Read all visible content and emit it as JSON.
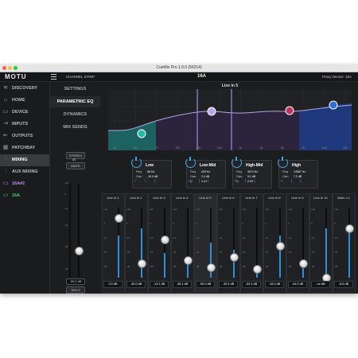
{
  "window": {
    "title": "CueMix Pro 1.0.0 (56214)"
  },
  "topbar": {
    "logo": "MOTU",
    "section": "CHANNEL STRIP",
    "channel": "16A",
    "proxy": "Proxy Device: 16A"
  },
  "sidebar": {
    "items": [
      {
        "label": "DISCOVERY",
        "icon": "wifi-icon"
      },
      {
        "label": "HOME",
        "icon": "home-icon"
      },
      {
        "label": "DEVICE",
        "icon": "device-icon"
      },
      {
        "label": "INPUTS",
        "icon": "input-icon"
      },
      {
        "label": "OUTPUTS",
        "icon": "output-icon"
      },
      {
        "label": "PATCHBAY",
        "icon": "grid-icon"
      },
      {
        "label": "MIXING",
        "icon": "mixer-icon"
      },
      {
        "label": "AUX MIXING",
        "icon": "aux-icon"
      },
      {
        "label": "16A#2",
        "icon": "device-icon"
      },
      {
        "label": "16A",
        "icon": "device-icon"
      }
    ]
  },
  "submenu": {
    "items": [
      "SETTINGS",
      "PARAMETRIC EQ",
      "DYNAMICS",
      "MIX SENDS"
    ]
  },
  "strip": {
    "stereo": "STEREO",
    "mute": "MUTE",
    "solo": "SOLO",
    "value": "-50.0 dB",
    "scale": [
      "+12",
      "0",
      "-12",
      "-24",
      "-48",
      "-72"
    ]
  },
  "eq": {
    "title": "Line In 5",
    "freq_labels": [
      "20",
      "50",
      "70",
      "100",
      "200",
      "500",
      "1k",
      "2k",
      "5k",
      "7k",
      "10k",
      "20k"
    ],
    "bands": [
      {
        "name": "Low",
        "freq_label": "Freq",
        "freq": "68 Hz",
        "gain_label": "Gain",
        "gain": "-10.0 dB"
      },
      {
        "name": "Low-Mid",
        "freq_label": "Freq",
        "freq": "429 Hz",
        "gain_label": "Gain",
        "gain": "2.4 dB",
        "q_label": "Q",
        "q": "1.14"
      },
      {
        "name": "High-Mid",
        "freq_label": "Freq",
        "freq": "3674 Hz",
        "gain_label": "Gain",
        "gain": "5.1 dB",
        "q_label": "Q",
        "q": "2.00"
      },
      {
        "name": "High",
        "freq_label": "Freq",
        "freq": "13087 Hz",
        "gain_label": "Gain",
        "gain": "7.2 dB"
      }
    ]
  },
  "mixer": {
    "channels": [
      {
        "name": "Line In 1",
        "value": "0.0 dB",
        "level": 0.85,
        "meter": 0.6
      },
      {
        "name": "Line In 2",
        "value": "-40.0 dB",
        "level": 0.2,
        "meter": 0.7
      },
      {
        "name": "Line In 3",
        "value": "-13.1 dB",
        "level": 0.55,
        "meter": 0.35
      },
      {
        "name": "Line In 4",
        "value": "-36.1 dB",
        "level": 0.25,
        "meter": 0.3
      },
      {
        "name": "Line In 5",
        "value": "-50.0 dB",
        "level": 0.15,
        "meter": 0.5
      },
      {
        "name": "Line In 6",
        "value": "-30.4 dB",
        "level": 0.3,
        "meter": 0.4
      },
      {
        "name": "Line In 7",
        "value": "-52.4 dB",
        "level": 0.12,
        "meter": 0.15
      },
      {
        "name": "Line In 8",
        "value": "-16.0 dB",
        "level": 0.45,
        "meter": 0.6
      },
      {
        "name": "Line In 9",
        "value": "-44.0 dB",
        "level": 0.2,
        "meter": 0.2
      },
      {
        "name": "Line In 10",
        "value": "-oo dB",
        "level": 0.0,
        "meter": 0.7
      },
      {
        "name": "Main 1-2",
        "value": "-8.6 dB",
        "level": 0.7,
        "meter": 0.75
      }
    ]
  },
  "colors": {
    "accent": "#3ca8e8",
    "low": "#26b9a6",
    "lowmid": "#9c8fd6",
    "highmid": "#c0325e",
    "high": "#2a6fd6"
  }
}
